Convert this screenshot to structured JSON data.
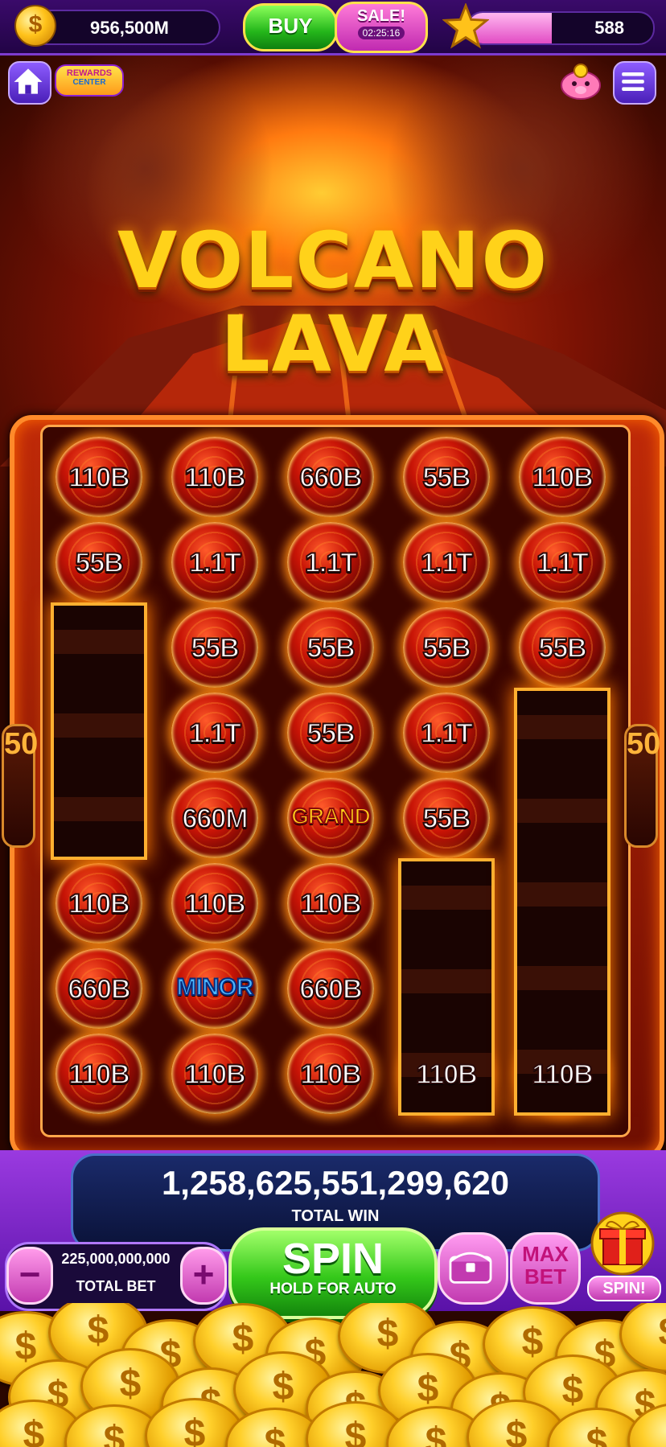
{
  "top_bar": {
    "balance": "956,500M",
    "buy_label": "BUY",
    "sale_label": "SALE!",
    "sale_timer": "02:25:16",
    "level": "588",
    "level_progress": 0.45
  },
  "nav": {
    "rewards_line1": "REWARDS",
    "rewards_line2": "CENTER"
  },
  "game": {
    "title_line1": "VOLCANO",
    "title_line2": "LAVA",
    "side_left": "50",
    "side_right": "50"
  },
  "reels": [
    [
      "110B",
      "55B",
      "",
      "",
      "",
      "110B",
      "660B",
      "110B"
    ],
    [
      "110B",
      "1.1T",
      "55B",
      "1.1T",
      "660M",
      "110B",
      "MINOR",
      "110B"
    ],
    [
      "660B",
      "1.1T",
      "55B",
      "55B",
      "GRAND",
      "110B",
      "660B",
      "110B"
    ],
    [
      "55B",
      "1.1T",
      "55B",
      "1.1T",
      "55B",
      "",
      "",
      "110B"
    ],
    [
      "110B",
      "1.1T",
      "55B",
      "",
      "",
      "",
      "",
      "110B"
    ]
  ],
  "total_win": {
    "value": "1,258,625,551,299,620",
    "label": "TOTAL WIN"
  },
  "controls": {
    "bet_value": "225,000,000,000",
    "bet_label": "TOTAL BET",
    "minus": "−",
    "plus": "+",
    "spin_label": "SPIN",
    "spin_sub": "HOLD FOR AUTO",
    "maxbet_line1": "MAX",
    "maxbet_line2": "BET",
    "gift_label": "SPIN!"
  },
  "colors": {
    "accent_purple": "#7d3bd0",
    "spin_green": "#34c81a",
    "lava_red": "#c81406",
    "gold": "#ffd21a"
  }
}
